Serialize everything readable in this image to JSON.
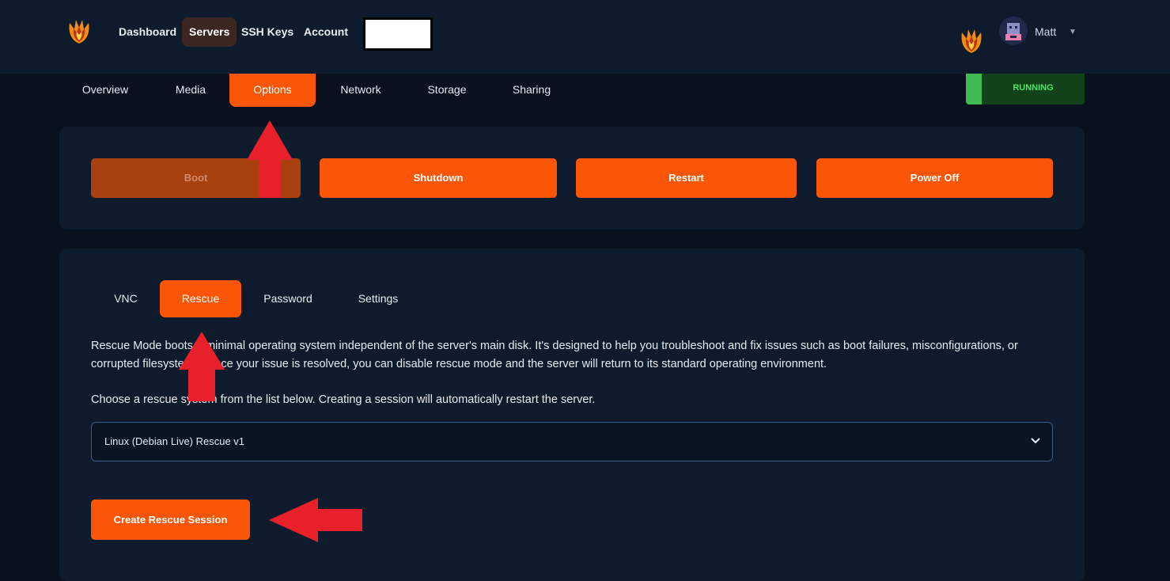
{
  "navbar": {
    "items": [
      {
        "label": "Dashboard",
        "active": false
      },
      {
        "label": "Servers",
        "active": true
      },
      {
        "label": "SSH Keys",
        "active": false
      },
      {
        "label": "Account",
        "active": false
      }
    ],
    "user": {
      "name": "Matt"
    }
  },
  "server_tabs": [
    {
      "label": "Overview",
      "active": false
    },
    {
      "label": "Media",
      "active": false
    },
    {
      "label": "Options",
      "active": true
    },
    {
      "label": "Network",
      "active": false
    },
    {
      "label": "Storage",
      "active": false
    },
    {
      "label": "Sharing",
      "active": false
    }
  ],
  "status": {
    "label": "RUNNING",
    "color": "#4be364"
  },
  "power_controls": {
    "boot": {
      "label": "Boot",
      "disabled": true
    },
    "shutdown": {
      "label": "Shutdown"
    },
    "restart": {
      "label": "Restart"
    },
    "power_off": {
      "label": "Power Off"
    }
  },
  "option_tabs": [
    {
      "label": "VNC",
      "active": false
    },
    {
      "label": "Rescue",
      "active": true
    },
    {
      "label": "Password",
      "active": false
    },
    {
      "label": "Settings",
      "active": false
    }
  ],
  "rescue": {
    "description_line1": "Rescue Mode boots a minimal operating system independent of the server's main disk. It's designed to help you troubleshoot and fix issues such as boot failures, misconfigurations, or",
    "description_line2": "corrupted filesystems. Once your issue is resolved, you can disable rescue mode and the server will return to its standard operating environment.",
    "choose_text": "Choose a rescue system from the list below. Creating a session will automatically restart the server.",
    "selected_system": "Linux (Debian Live) Rescue v1",
    "create_button": "Create Rescue Session"
  },
  "colors": {
    "accent": "#fb5607",
    "background": "#08111d",
    "panel": "#0e1b2c",
    "annotation_arrow": "#e8202a"
  }
}
